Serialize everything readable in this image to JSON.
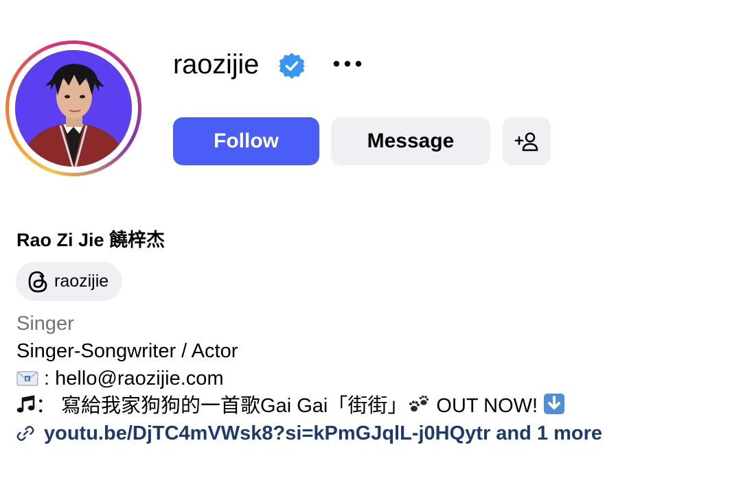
{
  "profile": {
    "username": "raozijie",
    "verified": true,
    "full_name": "Rao Zi Jie 饒梓杰",
    "threads_handle": "raozijie",
    "category": "Singer",
    "bio_lines": [
      "Singer-Songwriter / Actor",
      " : hello@raozijie.com",
      "：  寫給我家狗狗的一首歌Gai Gai「街街」",
      " OUT NOW! "
    ],
    "link_text": "youtu.be/DjTC4mVWsk8?si=kPmGJqlL-j0HQytr and 1 more"
  },
  "actions": {
    "follow_label": "Follow",
    "message_label": "Message"
  },
  "icons": {
    "verified": "verified-badge-icon",
    "more": "more-options-icon",
    "add_user": "add-person-icon",
    "threads": "threads-logo-icon",
    "email": "envelope-emoji-icon",
    "music": "music-note-emoji-icon",
    "paw": "paw-prints-emoji-icon",
    "down_arrow": "down-arrow-emoji-icon",
    "link": "link-icon"
  },
  "colors": {
    "follow_bg": "#4a5df7",
    "secondary_bg": "#eff0f3",
    "verified_blue": "#3897f0",
    "link_color": "#1d3a6e",
    "category_gray": "#737373",
    "avatar_bg": "#5b3ff0"
  }
}
